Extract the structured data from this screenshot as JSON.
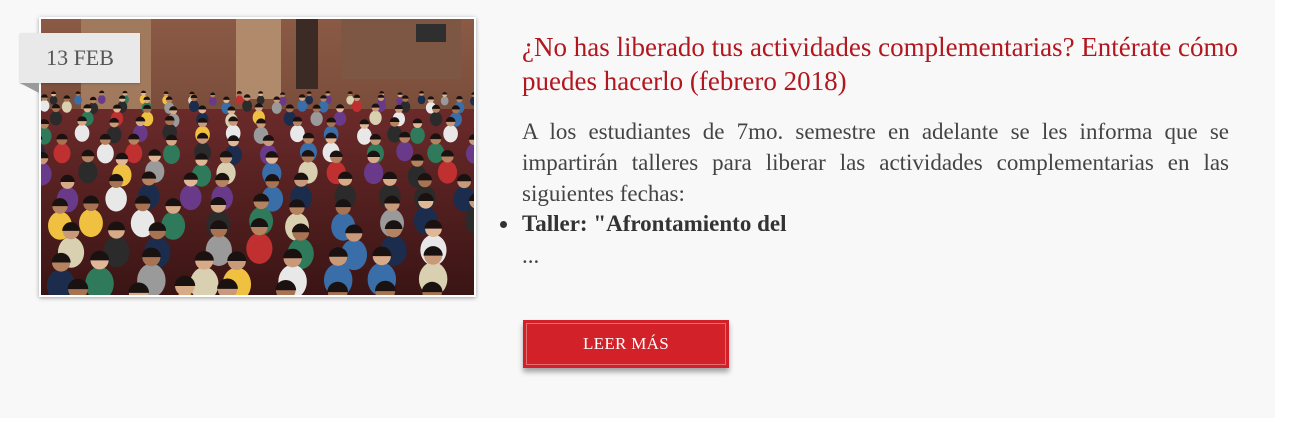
{
  "post": {
    "date": "13 FEB",
    "title": "¿No has liberado tus actividades complementarias? Entérate cómo puedes hacerlo (febrero 2018)",
    "excerpt": "A los estudiantes de 7mo. semestre en adelante se les informa que se impartirán talleres para liberar las actividades complementarias en las siguientes fechas:",
    "bullets": [
      "Taller: \"Afrontamiento del"
    ],
    "ellipsis": "...",
    "read_more_label": "LEER MÁS"
  },
  "colors": {
    "title": "#b2161e",
    "button": "#d22128",
    "card_background": "#f8f8f8",
    "date_badge": "#e9e9e9"
  },
  "image": {
    "subject": "auditorium-audience-photo"
  }
}
